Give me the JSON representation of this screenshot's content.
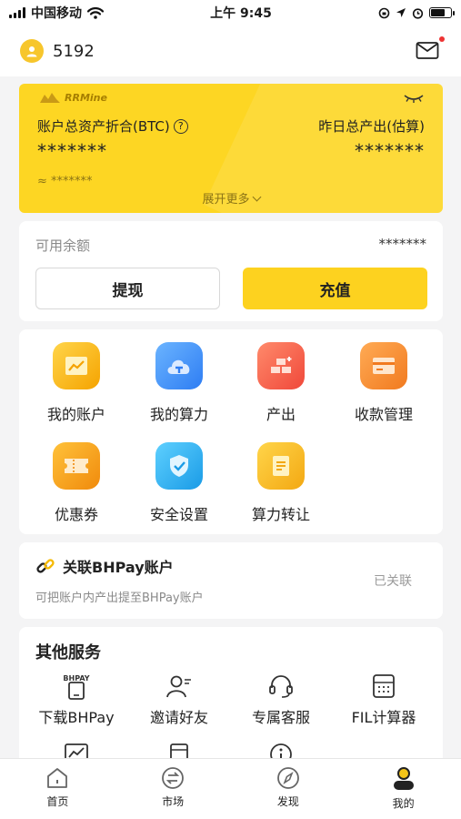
{
  "status_bar": {
    "carrier": "中国移动",
    "time": "上午 9:45"
  },
  "header": {
    "username": "5192"
  },
  "asset_card": {
    "brand": "RRMine",
    "total_label": "账户总资产折合(BTC)",
    "yesterday_label": "昨日总产出(估算)",
    "total_value": "*******",
    "yesterday_value": "*******",
    "approx_value": "≈ *******",
    "expand_label": "展开更多"
  },
  "balance": {
    "label": "可用余额",
    "value": "*******",
    "withdraw_label": "提现",
    "recharge_label": "充值"
  },
  "grid": {
    "items": [
      {
        "label": "我的账户"
      },
      {
        "label": "我的算力"
      },
      {
        "label": "产出"
      },
      {
        "label": "收款管理"
      },
      {
        "label": "优惠券"
      },
      {
        "label": "安全设置"
      },
      {
        "label": "算力转让"
      }
    ]
  },
  "bhpay": {
    "title": "关联BHPay账户",
    "subtitle": "可把账户内产出提至BHPay账户",
    "status": "已关联"
  },
  "services": {
    "title": "其他服务",
    "items": [
      {
        "label": "下载BHPay",
        "icon_text": "BHPAY"
      },
      {
        "label": "邀请好友"
      },
      {
        "label": "专属客服"
      },
      {
        "label": "FIL计算器"
      }
    ]
  },
  "tabbar": {
    "items": [
      {
        "label": "首页"
      },
      {
        "label": "市场"
      },
      {
        "label": "发现"
      },
      {
        "label": "我的"
      }
    ]
  },
  "colors": {
    "accent": "#fdd21f",
    "card": "#fdd623"
  }
}
